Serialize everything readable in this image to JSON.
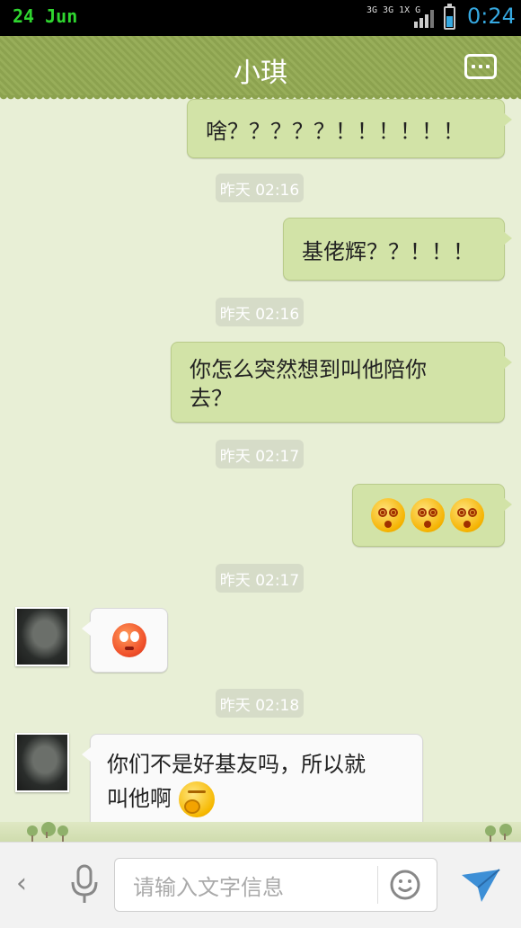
{
  "status_bar": {
    "date": "24 Jun",
    "network": "3G 3G 1X G",
    "time": "0:24"
  },
  "header": {
    "title": "小琪"
  },
  "messages": [
    {
      "type": "out",
      "text": "啥？？？？？！！！！！！"
    },
    {
      "type": "timestamp",
      "text": "昨天 02:16"
    },
    {
      "type": "out",
      "text": "基佬辉？？！！！"
    },
    {
      "type": "timestamp",
      "text": "昨天 02:16"
    },
    {
      "type": "out",
      "line1": "你怎么突然想到叫他陪你",
      "line2": "去？"
    },
    {
      "type": "timestamp",
      "text": "昨天 02:17"
    },
    {
      "type": "out",
      "emojis": [
        "dizzy-emoji",
        "dizzy-emoji",
        "dizzy-emoji"
      ]
    },
    {
      "type": "timestamp",
      "text": "昨天 02:17"
    },
    {
      "type": "in",
      "emojis": [
        "shocked-emoji"
      ]
    },
    {
      "type": "timestamp",
      "text": "昨天 02:18"
    },
    {
      "type": "in",
      "line1": "你们不是好基友吗，所以就",
      "line2": "叫他啊"
    }
  ],
  "input": {
    "placeholder": "请输入文字信息"
  },
  "icons": {
    "back": "chevron-left-icon",
    "mic": "microphone-icon",
    "emoji": "smiley-icon",
    "send": "send-icon",
    "menu": "more-icon"
  },
  "colors": {
    "title_bar": "#8ca24f",
    "out_bubble": "#d2e3a7",
    "in_bubble": "#fafafa",
    "background": "#e8efd6",
    "time_accent": "#36a9e1"
  }
}
